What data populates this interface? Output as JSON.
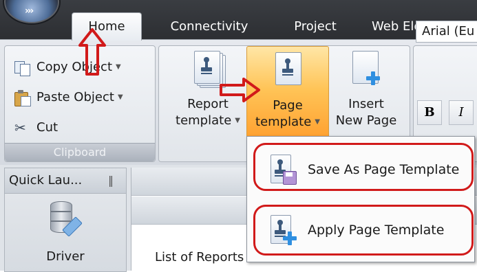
{
  "tabs": {
    "home": "Home",
    "connectivity": "Connectivity",
    "project": "Project",
    "web_elements": "Web Elements"
  },
  "clipboard": {
    "copy_object": "Copy Object",
    "paste_object": "Paste Object",
    "cut": "Cut",
    "caption": "Clipboard"
  },
  "template_group": {
    "report_template": [
      "Report",
      "template"
    ],
    "page_template": [
      "Page",
      "template"
    ],
    "insert_new_page": [
      "Insert",
      "New Page"
    ]
  },
  "font": {
    "font_name": "Arial (Eu",
    "bold": "B",
    "italic": "I"
  },
  "quick_launch": {
    "title": "Quick Lau...",
    "pin": "‖",
    "driver_label": "Driver"
  },
  "main": {
    "list_reports_label": "List of Reports"
  },
  "dropdown_menu": {
    "save_as_page_template": "Save As Page Template",
    "apply_page_template": "Apply Page Template"
  },
  "annotation_colors": {
    "highlight_red": "#d11a1a",
    "selected_orange": "#ffc457"
  },
  "icons": [
    "app-orb-icon",
    "copy-icon",
    "paste-icon",
    "scissors-icon",
    "report-template-icon",
    "page-template-icon",
    "insert-new-page-icon",
    "pin-icon",
    "driver-icon",
    "save-page-template-icon",
    "apply-page-template-icon",
    "dropdown-arrow-icon"
  ]
}
